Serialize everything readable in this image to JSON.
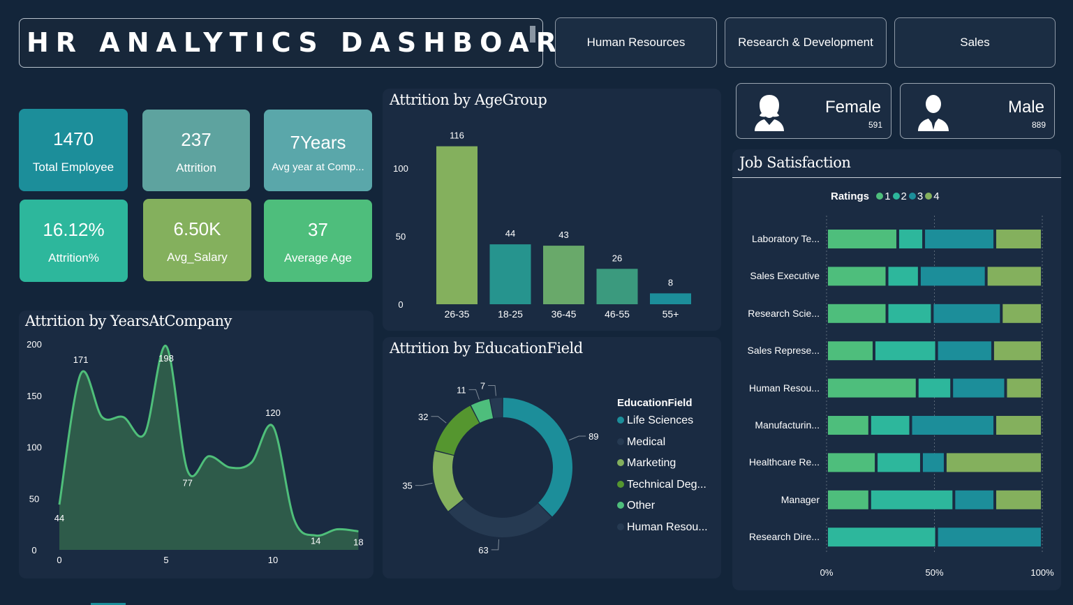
{
  "header": {
    "title": "HR ANALYTICS DASHBOAR"
  },
  "departments": [
    "Human Resources",
    "Research & Development",
    "Sales"
  ],
  "kpis": [
    {
      "value": "1470",
      "label": "Total Employee",
      "color": "#1c8e9a"
    },
    {
      "value": "237",
      "label": "Attrition",
      "color": "#5ea39f"
    },
    {
      "value": "7Years",
      "label": "Avg year at Comp...",
      "color": "#5aa7aa"
    },
    {
      "value": "16.12%",
      "label": "Attrition%",
      "color": "#2db79c"
    },
    {
      "value": "6.50K",
      "label": "Avg_Salary",
      "color": "#84b05d"
    },
    {
      "value": "37",
      "label": "Average Age",
      "color": "#4ebe7c"
    }
  ],
  "gender": {
    "female": {
      "label": "Female",
      "count": "591",
      "icon": "female-user-icon"
    },
    "male": {
      "label": "Male",
      "count": "889",
      "icon": "male-user-icon"
    }
  },
  "charts": {
    "years_title": "Attrition by YearsAtCompany",
    "age_title": "Attrition by AgeGroup",
    "edu_title": "Attrition by EducationField",
    "job_title": "Job Satisfaction"
  },
  "chart_data": [
    {
      "type": "bar",
      "title": "Attrition by AgeGroup",
      "categories": [
        "26-35",
        "18-25",
        "36-45",
        "46-55",
        "55+"
      ],
      "values": [
        116,
        44,
        43,
        26,
        8
      ],
      "colors": [
        "#84b05d",
        "#26948e",
        "#69a96a",
        "#3b9a7e",
        "#1c8e9a"
      ],
      "yticks": [
        0,
        50,
        100
      ],
      "ylim": [
        0,
        124
      ]
    },
    {
      "type": "area",
      "title": "Attrition by YearsAtCompany",
      "x": [
        0,
        1,
        2,
        3,
        4,
        5,
        6,
        7,
        8,
        9,
        10,
        11,
        12,
        13,
        14
      ],
      "values": [
        44,
        171,
        129,
        129,
        113,
        198,
        77,
        91,
        80,
        85,
        120,
        29,
        14,
        20,
        18
      ],
      "labeled_points": {
        "0": "44",
        "1": "171",
        "5": "198",
        "6": "77",
        "10": "120",
        "12": "14",
        "14": "18"
      },
      "xticks": [
        0,
        5,
        10
      ],
      "yticks": [
        0,
        50,
        100,
        150,
        200
      ],
      "ylim": [
        0,
        200
      ],
      "color": "#4fbf7a"
    },
    {
      "type": "pie",
      "title": "Attrition by EducationField",
      "legend_title": "EducationField",
      "legend_placement": "right",
      "categories": [
        "Life Sciences",
        "Medical",
        "Marketing",
        "Technical Deg...",
        "Other",
        "Human Resou..."
      ],
      "values": [
        89,
        63,
        35,
        32,
        11,
        7
      ],
      "colors": [
        "#1c8e9a",
        "#263a52",
        "#84b05d",
        "#55962f",
        "#4ebe7c",
        "#263a52"
      ]
    },
    {
      "type": "bar",
      "title": "Job Satisfaction",
      "legend_title": "Ratings",
      "legend_placement": "top",
      "stacked": "percent",
      "categories": [
        "Laboratory Te...",
        "Sales Executive",
        "Research Scie...",
        "Sales Represe...",
        "Human Resou...",
        "Manufacturin...",
        "Healthcare Re...",
        "Manager",
        "Research Dire..."
      ],
      "series": [
        {
          "name": "1",
          "color": "#4ebe7c",
          "values": [
            33,
            28,
            28,
            22,
            42,
            20,
            23,
            20,
            0
          ]
        },
        {
          "name": "2",
          "color": "#2db79c",
          "values": [
            12,
            15,
            21,
            29,
            16,
            19,
            21,
            39,
            51
          ]
        },
        {
          "name": "3",
          "color": "#1c8e9a",
          "values": [
            33,
            31,
            32,
            26,
            25,
            39,
            11,
            19,
            49
          ]
        },
        {
          "name": "4",
          "color": "#84b05d",
          "values": [
            22,
            26,
            19,
            23,
            17,
            22,
            45,
            22,
            0
          ]
        }
      ],
      "xticks": [
        "0%",
        "50%",
        "100%"
      ]
    }
  ]
}
